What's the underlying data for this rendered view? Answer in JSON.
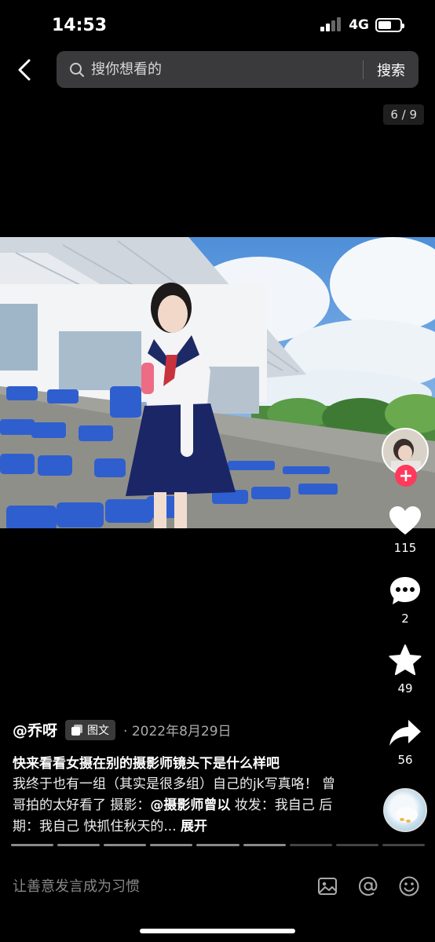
{
  "status_bar": {
    "time": "14:53",
    "network": "4G",
    "battery_level": 0.62
  },
  "search": {
    "placeholder": "搜你想看的",
    "button_label": "搜索"
  },
  "gallery": {
    "page_indicator": "6 / 9",
    "current": 6,
    "total": 9
  },
  "actions": {
    "likes": "115",
    "comments": "2",
    "favorites": "49",
    "shares": "56",
    "follow_symbol": "+"
  },
  "post": {
    "author": "@乔呀",
    "type_badge": "图文",
    "date": "· 2022年8月29日",
    "title": "快来看看女摄在别的摄影师镜头下是什么样吧",
    "body_before": "我终于也有一组（其实是很多组）自己的jk写真咯！ 曾哥拍的太好看了 摄影：",
    "mention": "@摄影师曾以",
    "body_after": " 妆发：我自己 后期：我自己 快抓住秋天的...",
    "expand_label": "展开"
  },
  "comment_bar": {
    "placeholder": "让善意发言成为习惯"
  },
  "icons": {
    "back": "back-arrow-icon",
    "search": "search-icon",
    "like": "heart-icon",
    "comment": "comment-bubble-icon",
    "favorite": "star-icon",
    "share": "share-arrow-icon",
    "image": "image-icon",
    "mention": "at-icon",
    "emoji": "emoji-icon"
  },
  "colors": {
    "background": "#000000",
    "follow": "#ff3a5c",
    "search_bg": "#3a3a3c"
  }
}
